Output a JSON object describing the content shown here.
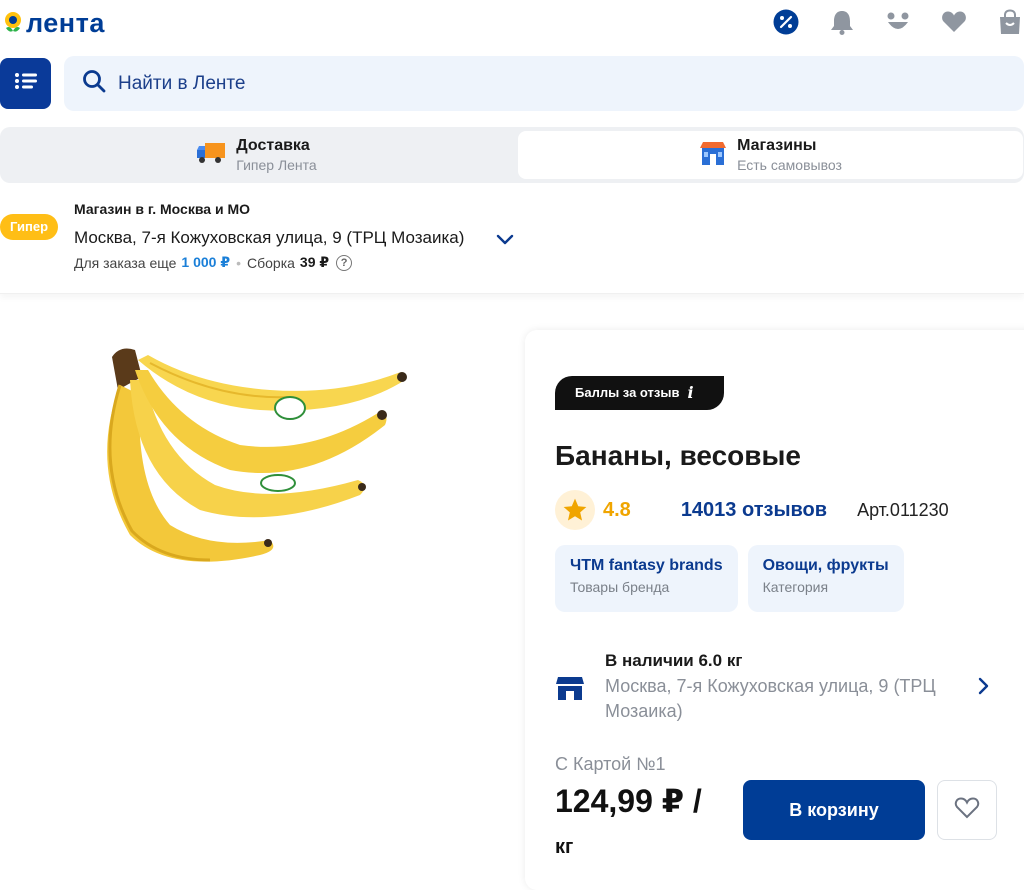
{
  "header": {
    "logo_text": "лента",
    "icons": [
      "discount-icon",
      "bell-icon",
      "face-icon",
      "heart-icon",
      "bag-icon"
    ],
    "brand_color": "#003d96"
  },
  "search": {
    "placeholder": "Найти в Ленте"
  },
  "modes": {
    "delivery": {
      "title": "Доставка",
      "subtitle": "Гипер Лента"
    },
    "shops": {
      "title": "Магазины",
      "subtitle": "Есть самовывоз"
    }
  },
  "store": {
    "badge": "Гипер",
    "title": "Магазин в г. Москва и МО",
    "address": "Москва, 7-я Кожуховская улица, 9 (ТРЦ Мозаика)",
    "order_label": "Для заказа еще",
    "order_amount": "1 000 ₽",
    "assembly_label": "Сборка",
    "assembly_price": "39 ₽",
    "help": "?"
  },
  "product": {
    "review_badge": "Баллы за отзыв",
    "review_badge_icon": "i",
    "title": "Бананы, весовые",
    "rating": "4.8",
    "reviews": "14013 отзывов",
    "sku": "Арт.011230",
    "tags": [
      {
        "title": "ЧТМ fantasy brands",
        "subtitle": "Товары бренда"
      },
      {
        "title": "Овощи, фрукты",
        "subtitle": "Категория"
      }
    ],
    "availability": {
      "title": "В наличии 6.0 кг",
      "address": "Москва, 7-я Кожуховская улица, 9 (ТРЦ Мозаика)"
    },
    "price_label": "С Картой №1",
    "price": "124,99 ₽ /",
    "unit": "кг",
    "cart_button": "В корзину"
  }
}
